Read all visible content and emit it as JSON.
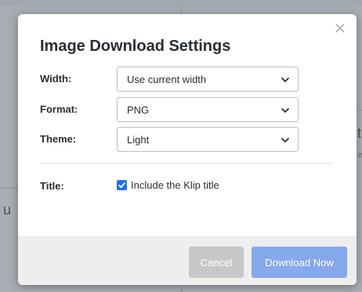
{
  "background": {
    "fragment_left": "u",
    "fragment_right": "ti",
    "fragment_right_small": "e"
  },
  "modal": {
    "title": "Image Download Settings",
    "close_icon": "close-icon",
    "fields": [
      {
        "label": "Width:",
        "value": "Use current width"
      },
      {
        "label": "Format:",
        "value": "PNG"
      },
      {
        "label": "Theme:",
        "value": "Light"
      }
    ],
    "title_option": {
      "label": "Title:",
      "checkbox_label": "Include the Klip title",
      "checked": true
    },
    "buttons": {
      "cancel": "Cancel",
      "download": "Download Now"
    }
  },
  "colors": {
    "checkbox": "#1e73e8",
    "primary_button": "#86a8ec",
    "disabled_button": "#c7c8ca"
  }
}
